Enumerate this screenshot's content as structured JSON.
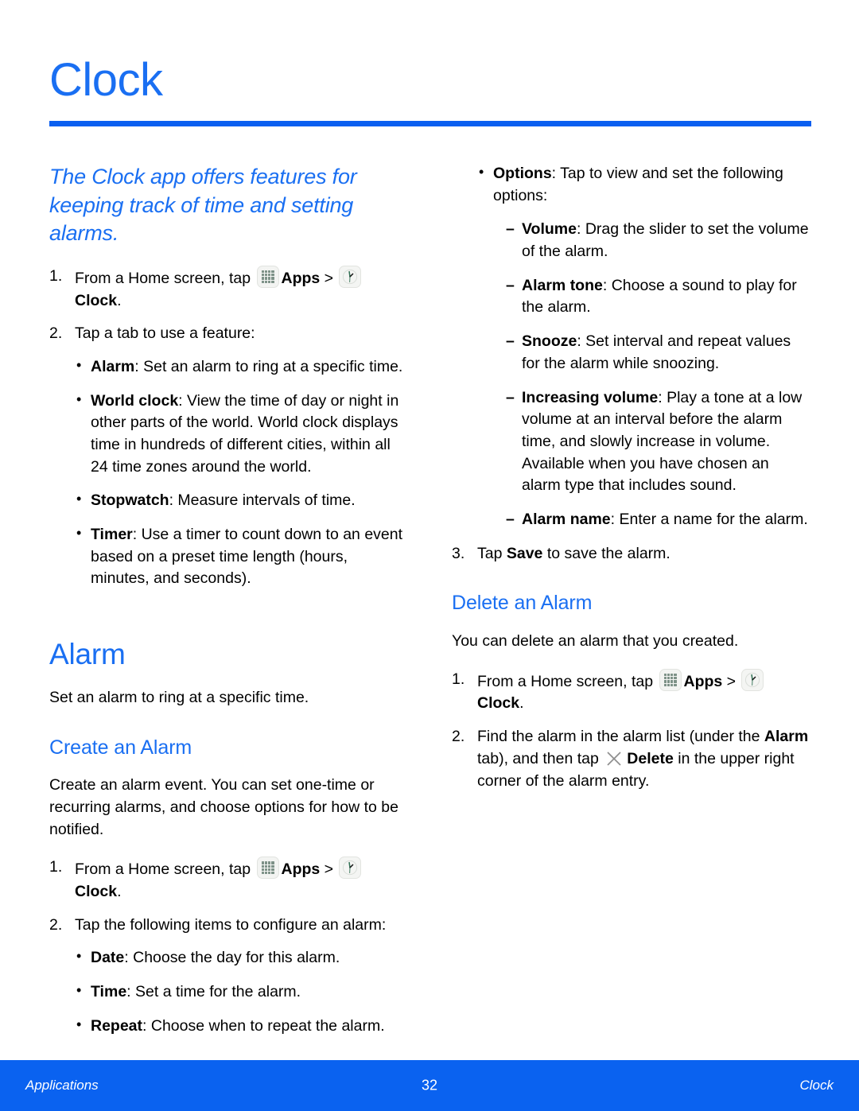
{
  "page": {
    "title": "Clock",
    "accent_color": "#0a5ff0",
    "heading_color": "#1a6ff2"
  },
  "left_column": {
    "lede": "The Clock app offers features for keeping track of time and setting alarms.",
    "steps": [
      {
        "num": "1.",
        "pre": "From a Home screen, tap ",
        "apps_label": "Apps",
        "sep": " > ",
        "clock_label": "Clock",
        "post": "."
      },
      {
        "num": "2.",
        "text": "Tap a tab to use a feature:"
      }
    ],
    "feature_bullets": [
      {
        "mark": "•",
        "term": "Alarm",
        "rest": ": Set an alarm to ring at a specific time."
      },
      {
        "mark": "•",
        "term": "World clock",
        "rest": ": View the time of day or night in other parts of the world. World clock displays time in hundreds of different cities, within all 24 time zones around the world."
      },
      {
        "mark": "•",
        "term": "Stopwatch",
        "rest": ": Measure intervals of time."
      },
      {
        "mark": "•",
        "term": "Timer",
        "rest": ": Use a timer to count down to an event based on a preset time length (hours, minutes, and seconds)."
      }
    ],
    "alarm_section": {
      "heading": "Alarm",
      "intro": "Set an alarm to ring at a specific time.",
      "subheading": "Create an Alarm",
      "sub_intro": "Create an alarm event. You can set one-time or recurring alarms, and choose options for how to be notified.",
      "steps": [
        {
          "num": "1.",
          "pre": "From a Home screen, tap ",
          "apps_label": "Apps",
          "sep": " > ",
          "clock_label": "Clock",
          "post": "."
        },
        {
          "num": "2.",
          "text": "Tap the following items to configure an alarm:"
        }
      ],
      "config_bullets": [
        {
          "mark": "•",
          "term": "Date",
          "rest": ": Choose the day for this alarm."
        },
        {
          "mark": "•",
          "term": "Time",
          "rest": ": Set a time for the alarm."
        },
        {
          "mark": "•",
          "term": "Repeat",
          "rest": ": Choose when to repeat the alarm."
        }
      ]
    }
  },
  "right_column": {
    "options_bullet": {
      "mark": "•",
      "term": "Options",
      "rest": ": Tap to view and set the following options:"
    },
    "option_items": [
      {
        "mark": "–",
        "term": "Volume",
        "rest": ": Drag the slider to set the volume of the alarm."
      },
      {
        "mark": "–",
        "term": "Alarm tone",
        "rest": ": Choose a sound to play for the alarm."
      },
      {
        "mark": "–",
        "term": "Snooze",
        "rest": ": Set interval and repeat values for the alarm while snoozing."
      },
      {
        "mark": "–",
        "term": "Increasing volume",
        "rest": ": Play a tone at a low volume at an interval before the alarm time, and slowly increase in volume. Available when you have chosen an alarm type that includes sound."
      },
      {
        "mark": "–",
        "term": "Alarm name",
        "rest": ": Enter a name for the alarm."
      }
    ],
    "save_step": {
      "num": "3.",
      "pre": "Tap ",
      "bold": "Save",
      "post": " to save the alarm."
    },
    "delete_section": {
      "heading": "Delete an Alarm",
      "intro": "You can delete an alarm that you created.",
      "step1": {
        "num": "1.",
        "pre": "From a Home screen, tap ",
        "apps_label": "Apps",
        "sep": " > ",
        "clock_label": "Clock",
        "post": "."
      },
      "step2": {
        "num": "2.",
        "pre": "Find the alarm in the alarm list (under the ",
        "bold1": "Alarm",
        "mid": " tab), and then tap ",
        "bold2": "Delete",
        "post": " in the upper right corner of the alarm entry."
      }
    }
  },
  "footer": {
    "left": "Applications",
    "page_number": "32",
    "right": "Clock"
  }
}
